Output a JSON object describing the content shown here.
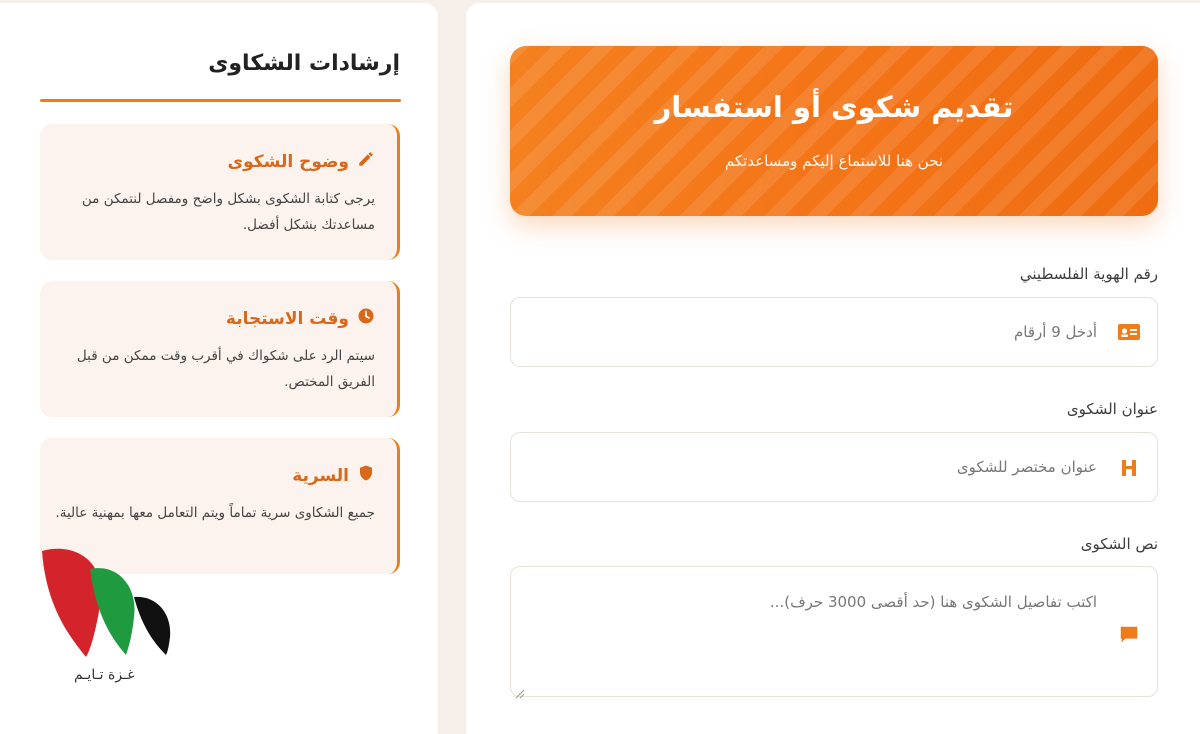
{
  "guidelines": {
    "title": "إرشادات الشكاوى",
    "items": [
      {
        "title": "وضوح الشكوى",
        "text": "يرجى كتابة الشكوى بشكل واضح ومفصل لنتمكن من مساعدتك بشكل أفضل.",
        "icon": "pencil-icon"
      },
      {
        "title": "وقت الاستجابة",
        "text": "سيتم الرد على شكواك في أقرب وقت ممكن من قبل الفريق المختص.",
        "icon": "clock-icon"
      },
      {
        "title": "السرية",
        "text": "جميع الشكاوى سرية تماماً ويتم التعامل معها بمهنية عالية.",
        "icon": "shield-icon"
      }
    ]
  },
  "form": {
    "header": {
      "title": "تقديم شكوى أو استفسار",
      "subtitle": "نحن هنا للاستماع إليكم ومساعدتكم"
    },
    "fields": [
      {
        "label": "رقم الهوية الفلسطيني",
        "placeholder": "أدخل 9 أرقام",
        "icon": "id-card-icon"
      },
      {
        "label": "عنوان الشكوى",
        "placeholder": "عنوان مختصر للشكوى",
        "icon": "heading-icon"
      },
      {
        "label": "نص الشكوى",
        "placeholder": "اكتب تفاصيل الشكوى هنا (حد أقصى 3000 حرف)...",
        "icon": "comment-icon"
      }
    ]
  },
  "watermark": {
    "text": "غـزة تـايـم"
  },
  "colors": {
    "accent": "#ee7c1a",
    "accent_dark": "#d8681a",
    "tip_bg": "#fcf3ee",
    "page_bg": "#f6efe9"
  }
}
